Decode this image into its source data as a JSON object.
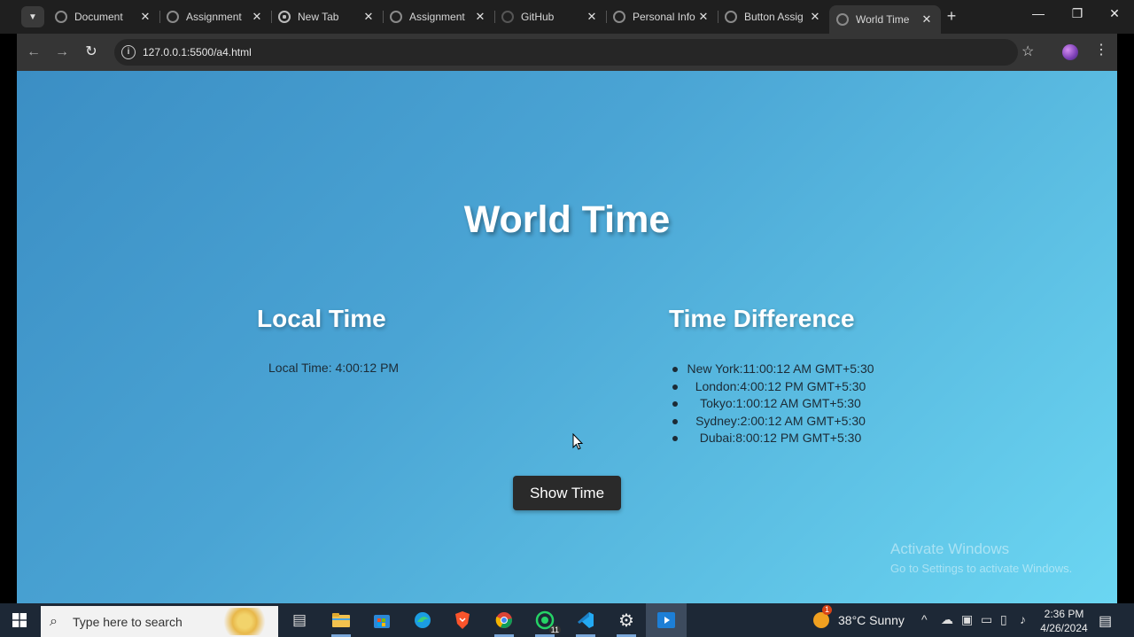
{
  "browser": {
    "tabs": [
      {
        "label": "Document",
        "icon": "globe-icon",
        "active": false
      },
      {
        "label": "Assignment",
        "icon": "globe-icon",
        "active": false
      },
      {
        "label": "New Tab",
        "icon": "chrome-icon",
        "active": false
      },
      {
        "label": "Assignment",
        "icon": "globe-icon",
        "active": false
      },
      {
        "label": "GitHub",
        "icon": "github-icon",
        "active": false
      },
      {
        "label": "Personal Info",
        "icon": "globe-icon",
        "active": false
      },
      {
        "label": "Button Assig",
        "icon": "globe-icon",
        "active": false
      },
      {
        "label": "World Time",
        "icon": "globe-icon",
        "active": true
      }
    ],
    "url": "127.0.0.1:5500/a4.html"
  },
  "page": {
    "title": "World Time",
    "local_heading": "Local Time",
    "local_line": "Local Time: 4:00:12 PM",
    "diff_heading": "Time Difference",
    "zones": [
      "New York:11:00:12 AM GMT+5:30",
      "London:4:00:12 PM GMT+5:30",
      "Tokyo:1:00:12 AM GMT+5:30",
      "Sydney:2:00:12 AM GMT+5:30",
      "Dubai:8:00:12 PM GMT+5:30"
    ],
    "button_label": "Show Time",
    "background_gradient": [
      "#3b8ec4",
      "#6bd6f2"
    ]
  },
  "watermark": {
    "line1": "Activate Windows",
    "line2": "Go to Settings to activate Windows."
  },
  "taskbar": {
    "search_placeholder": "Type here to search",
    "whatsapp_badge": "11",
    "weather": "38°C  Sunny",
    "weather_badge": "1",
    "time": "2:36 PM",
    "date": "4/26/2024"
  }
}
